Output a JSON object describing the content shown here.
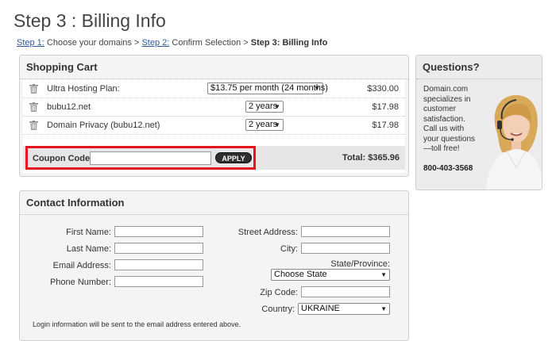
{
  "page": {
    "title": "Step 3 : Billing Info"
  },
  "breadcrumb": {
    "step1_link": "Step 1:",
    "step1_text": " Choose your domains > ",
    "step2_link": "Step 2:",
    "step2_text": " Confirm Selection > ",
    "step3": "Step 3: Billing Info"
  },
  "cart": {
    "title": "Shopping Cart",
    "items": [
      {
        "name": "Ultra Hosting Plan:",
        "term": "$13.75 per month (24 months)",
        "price": "$330.00"
      },
      {
        "name": "bubu12.net",
        "term": "2 years",
        "price": "$17.98"
      },
      {
        "name": "Domain Privacy (bubu12.net)",
        "term": "2 years",
        "price": "$17.98"
      }
    ],
    "coupon_label": "Coupon Code:",
    "coupon_value": "",
    "apply_label": "APPLY",
    "total": "Total: $365.96",
    "highlight_color": "#e2141e"
  },
  "questions": {
    "title": "Questions?",
    "text": "Domain.com specializes in customer satisfaction. Call us with your questions—toll free!",
    "phone": "800-403-3568"
  },
  "contact": {
    "title": "Contact Information",
    "first_name_label": "First Name:",
    "last_name_label": "Last Name:",
    "email_label": "Email Address:",
    "phone_label": "Phone Number:",
    "street_label": "Street Address:",
    "city_label": "City:",
    "state_label": "State/Province:",
    "state_value": "Choose State",
    "zip_label": "Zip Code:",
    "country_label": "Country:",
    "country_value": "UKRAINE",
    "note": "Login information will be sent to the email address entered above."
  }
}
